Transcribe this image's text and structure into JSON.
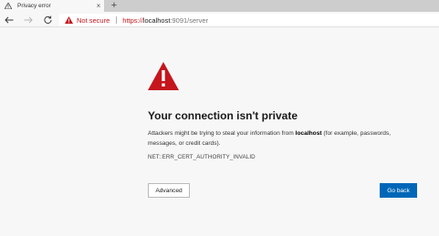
{
  "tab": {
    "title": "Privacy error",
    "close_glyph": "×",
    "new_tab_glyph": "+",
    "warn_icon": "warning-triangle-icon"
  },
  "toolbar": {
    "back_icon": "back-arrow-icon",
    "forward_icon": "forward-arrow-icon",
    "refresh_icon": "refresh-icon"
  },
  "address": {
    "security_label": "Not secure",
    "url_scheme": "https://",
    "url_host": "localhost",
    "url_rest": ":9091/server"
  },
  "page": {
    "heading": "Your connection isn't private",
    "desc_before": "Attackers might be trying to steal your information from ",
    "desc_host": "localhost",
    "desc_after": " (for example, passwords, messages, or credit cards).",
    "error_code": "NET::ERR_CERT_AUTHORITY_INVALID",
    "advanced_label": "Advanced",
    "back_label": "Go back"
  },
  "colors": {
    "warning_red": "#c4161c",
    "button_blue": "#0067b8",
    "page_bg": "#f7f7f7"
  }
}
